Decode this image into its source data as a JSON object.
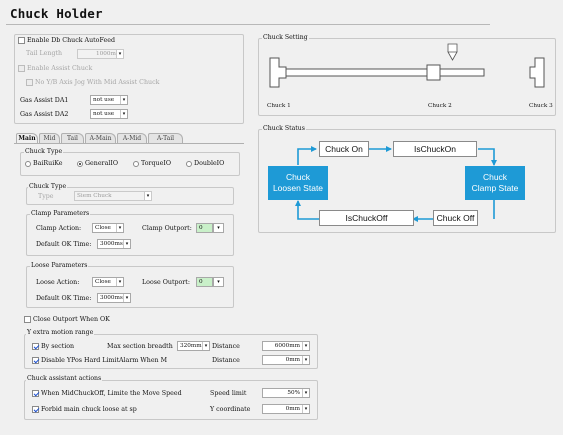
{
  "title": "Chuck Holder",
  "top": {
    "enable_db_chuck": "Enable Db Chuck AutoFeed",
    "tail_length_label": "Tail Length",
    "tail_length_value": "1000mm",
    "enable_assist": "Enable Assist Chuck",
    "no_yb_axis": "No Y/B Axis Jog With Mid Assist Chuck",
    "gas_da1_label": "Gas Assist DA1",
    "gas_da1_value": "not use",
    "gas_da2_label": "Gas Assist DA2",
    "gas_da2_value": "not use"
  },
  "tabs": [
    "Main",
    "Mid",
    "Tail",
    "A-Main",
    "A-Mid",
    "A-Tail"
  ],
  "chuck_type_group": {
    "legend": "Chuck Type",
    "options": [
      "BaiRuiKe",
      "GeneralIO",
      "TorqueIO",
      "DoubleIO"
    ],
    "selected": "GeneralIO"
  },
  "chuck_type2": {
    "legend": "Chuck Type",
    "type_label": "Type",
    "type_value": "Siem Chuck"
  },
  "clamp": {
    "legend": "Clamp Parameters",
    "action_label": "Clamp Action:",
    "action_value": "Close",
    "outport_label": "Clamp Outport:",
    "outport_value": "0",
    "ok_label": "Default OK Time:",
    "ok_value": "3000ms"
  },
  "loose": {
    "legend": "Loose Parameters",
    "action_label": "Loose Action:",
    "action_value": "Close",
    "outport_label": "Loose Outport:",
    "outport_value": "0",
    "ok_label": "Default OK Time:",
    "ok_value": "3000ms"
  },
  "close_outport": "Close Outport When OK",
  "y_extra": {
    "legend": "Y extra motion range",
    "by_section": "By section",
    "max_breadth_label": "Max section breadth",
    "max_breadth_value": "320mm",
    "distance_label1": "Distance",
    "distance_value1": "6000mm",
    "disable_limit": "Disable YPos Hard LimitAlarm When M",
    "distance_label2": "Distance",
    "distance_value2": "0mm"
  },
  "assist_actions": {
    "legend": "Chuck assistant actions",
    "when_mid": "When MidChuckOff, Limite the Move Speed",
    "speed_label": "Speed limit",
    "speed_value": "50%",
    "forbid": "Forbid main chuck loose at sp",
    "ycoord_label": "Y coordinate",
    "ycoord_value": "0mm"
  },
  "chuck_setting": {
    "legend": "Chuck Setting",
    "chuck1": "Chuck 1",
    "chuck2": "Chuck 2",
    "chuck3": "Chuck 3"
  },
  "chuck_status": {
    "legend": "Chuck Status",
    "chuck_on": "Chuck On",
    "is_chuck_on": "IsChuckOn",
    "clamp_state": "Chuck\nClamp State",
    "chuck_off": "Chuck Off",
    "is_chuck_off": "IsChuckOff",
    "loosen_state": "Chuck\nLoosen State"
  },
  "colors": {
    "accent_blue": "#1e9ad6",
    "selected_green": "#c9f0c9"
  }
}
